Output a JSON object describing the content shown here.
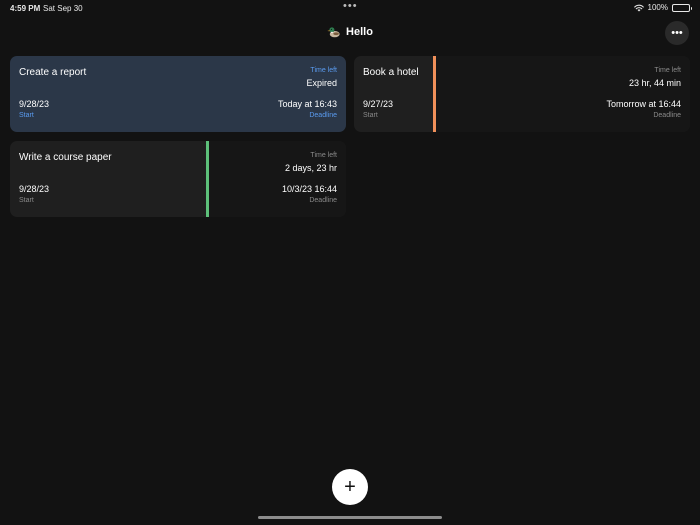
{
  "status_bar": {
    "time": "4:59 PM",
    "date": "Sat Sep 30",
    "battery": "100%",
    "battery_level": 1.0
  },
  "header": {
    "title": "Hello",
    "more_label": "•••"
  },
  "cards": [
    {
      "title": "Create a report",
      "start_date": "9/28/23",
      "start_label": "Start",
      "time_left_label": "Time left",
      "time_left": "Expired",
      "deadline": "Today at 16:43",
      "deadline_label": "Deadline",
      "highlighted": true,
      "accent_color": "#5a9bf0"
    },
    {
      "title": "Book a hotel",
      "start_date": "9/27/23",
      "start_label": "Start",
      "time_left_label": "Time left",
      "time_left": "23 hr, 44 min",
      "deadline": "Tomorrow at 16:44",
      "deadline_label": "Deadline",
      "progress_fraction": 0.24,
      "progress_color": "#f0905a"
    },
    {
      "title": "Write a course paper",
      "start_date": "9/28/23",
      "start_label": "Start",
      "time_left_label": "Time left",
      "time_left": "2 days, 23 hr",
      "deadline": "10/3/23 16:44",
      "deadline_label": "Deadline",
      "progress_fraction": 0.59,
      "progress_color": "#5dc07a"
    }
  ],
  "add_button": {
    "label": "+"
  },
  "icons": {
    "header": "duck-icon",
    "wifi": "wifi-icon",
    "battery": "battery-icon"
  }
}
